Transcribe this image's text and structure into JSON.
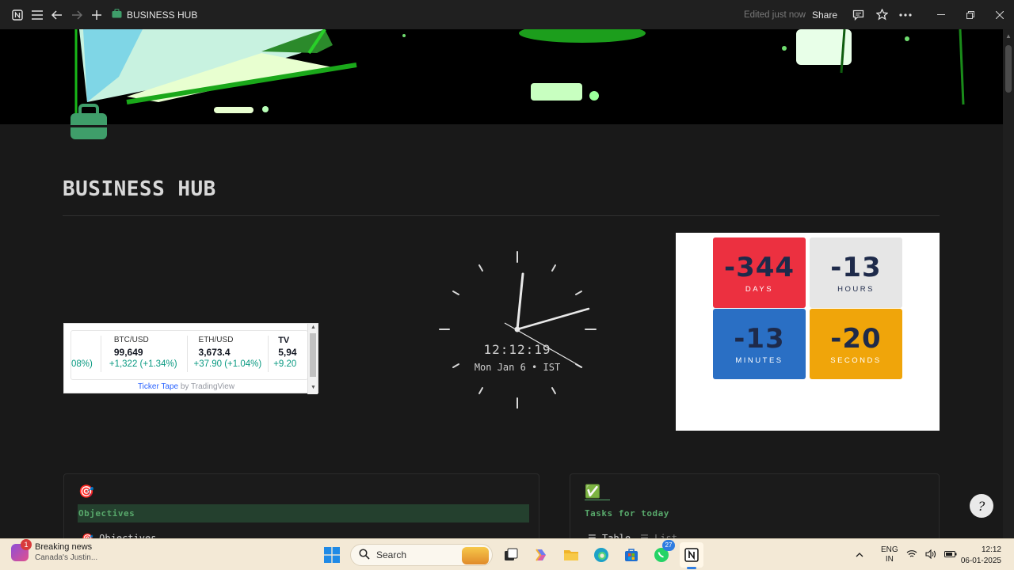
{
  "titlebar": {
    "title": "BUSINESS HUB",
    "edited": "Edited just now",
    "share": "Share"
  },
  "page": {
    "title": "BUSINESS HUB"
  },
  "ticker": {
    "items": [
      {
        "symbol": "",
        "price": "",
        "change": "08%)"
      },
      {
        "symbol": "BTC/USD",
        "price": "99,649",
        "change": "+1,322 (+1.34%)"
      },
      {
        "symbol": "ETH/USD",
        "price": "3,673.4",
        "change": "+37.90 (+1.04%)"
      },
      {
        "symbol": "",
        "price": "5,94",
        "change": "+9.20"
      }
    ],
    "footer_link": "Ticker Tape",
    "footer_by": " by TradingView",
    "logo": "TV",
    "colors": {
      "positive": "#089981",
      "link": "#2962ff"
    }
  },
  "clock": {
    "time": "12:12:19",
    "date": "Mon Jan 6 • IST"
  },
  "countdown": {
    "days": {
      "value": "-344",
      "label": "DAYS",
      "color": "#ec3040"
    },
    "hours": {
      "value": "-13",
      "label": "HOURS",
      "color": "#e6e6e6"
    },
    "minutes": {
      "value": "-13",
      "label": "MINUTES",
      "color": "#2a6fc4"
    },
    "seconds": {
      "value": "-20",
      "label": "SECONDS",
      "color": "#f0a50a"
    }
  },
  "objectives": {
    "emoji": "🎯",
    "heading": "Objectives",
    "sub": "🎯 Objectives"
  },
  "tasks": {
    "emoji": "✅",
    "heading": "Tasks for today",
    "view_table": "☰ Table",
    "view_list": "☰ List"
  },
  "taskbar": {
    "news_badge": "1",
    "news_title": "Breaking news",
    "news_sub": "Canada's Justin...",
    "search": "Search",
    "whatsapp_badge": "27",
    "lang_top": "ENG",
    "lang_bottom": "IN",
    "time": "12:12",
    "date": "06-01-2025"
  },
  "accent": {
    "green": "#58a86b",
    "notion_bg": "#191919"
  }
}
